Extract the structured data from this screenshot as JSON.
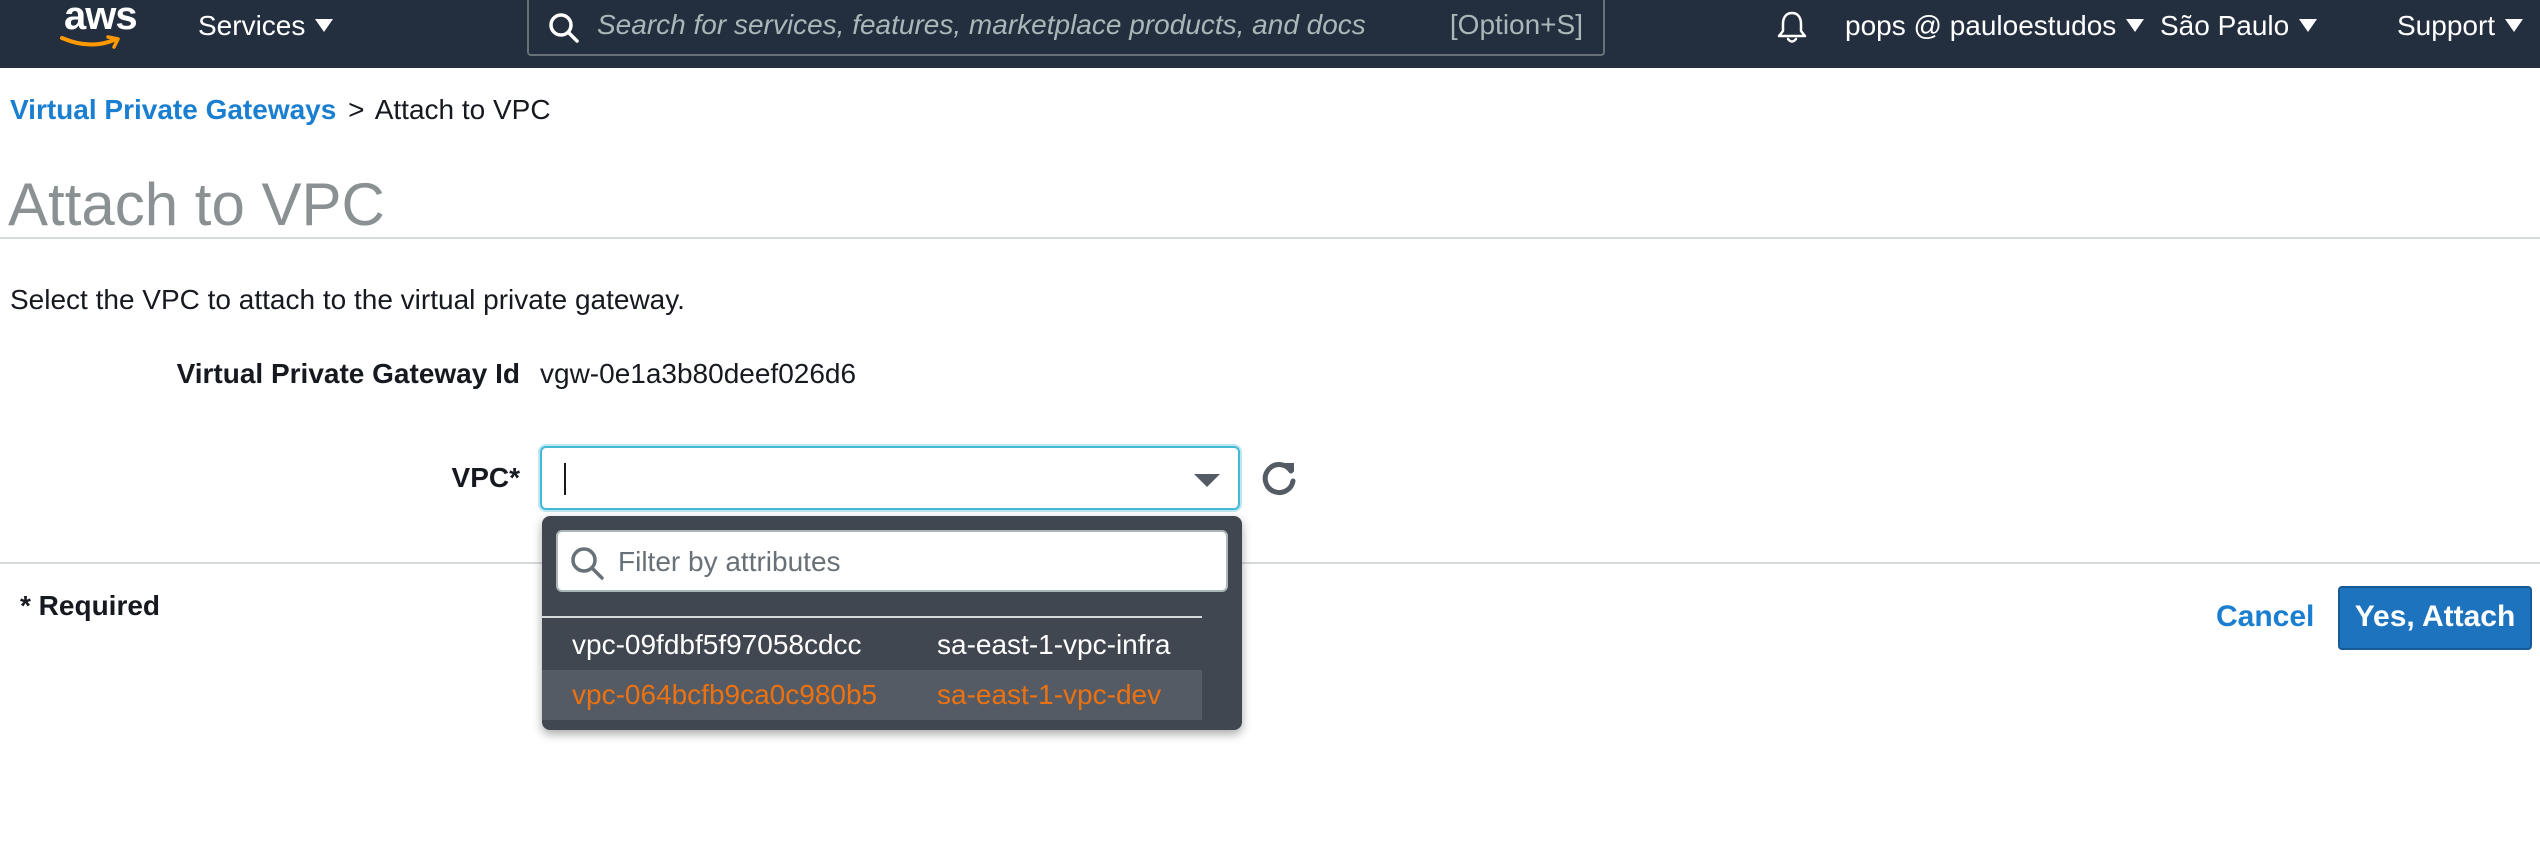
{
  "nav": {
    "logo_text": "aws",
    "services_label": "Services",
    "search_placeholder": "Search for services, features, marketplace products, and docs",
    "search_shortcut": "[Option+S]",
    "account_label": "pops @ pauloestudos",
    "region_label": "São Paulo",
    "support_label": "Support"
  },
  "breadcrumb": {
    "parent": "Virtual Private Gateways",
    "separator": ">",
    "current": "Attach to VPC"
  },
  "page": {
    "title": "Attach to VPC",
    "description": "Select the VPC to attach to the virtual private gateway."
  },
  "form": {
    "vgw_label": "Virtual Private Gateway Id",
    "vgw_value": "vgw-0e1a3b80deef026d6",
    "vpc_label": "VPC*",
    "vpc_value": "",
    "filter_placeholder": "Filter by attributes",
    "options": [
      {
        "id": "vpc-09fdbf5f97058cdcc",
        "name": "sa-east-1-vpc-infra",
        "highlighted": false
      },
      {
        "id": "vpc-064bcfb9ca0c980b5",
        "name": "sa-east-1-vpc-dev",
        "highlighted": true
      }
    ]
  },
  "footer": {
    "required_note": "* Required",
    "cancel_label": "Cancel",
    "attach_label": "Yes, Attach"
  },
  "colors": {
    "nav_bg": "#232f3e",
    "link": "#1a7ed1",
    "primary_button": "#1e73be",
    "highlight_option": "#ec7211",
    "dropdown_bg": "#414750"
  }
}
